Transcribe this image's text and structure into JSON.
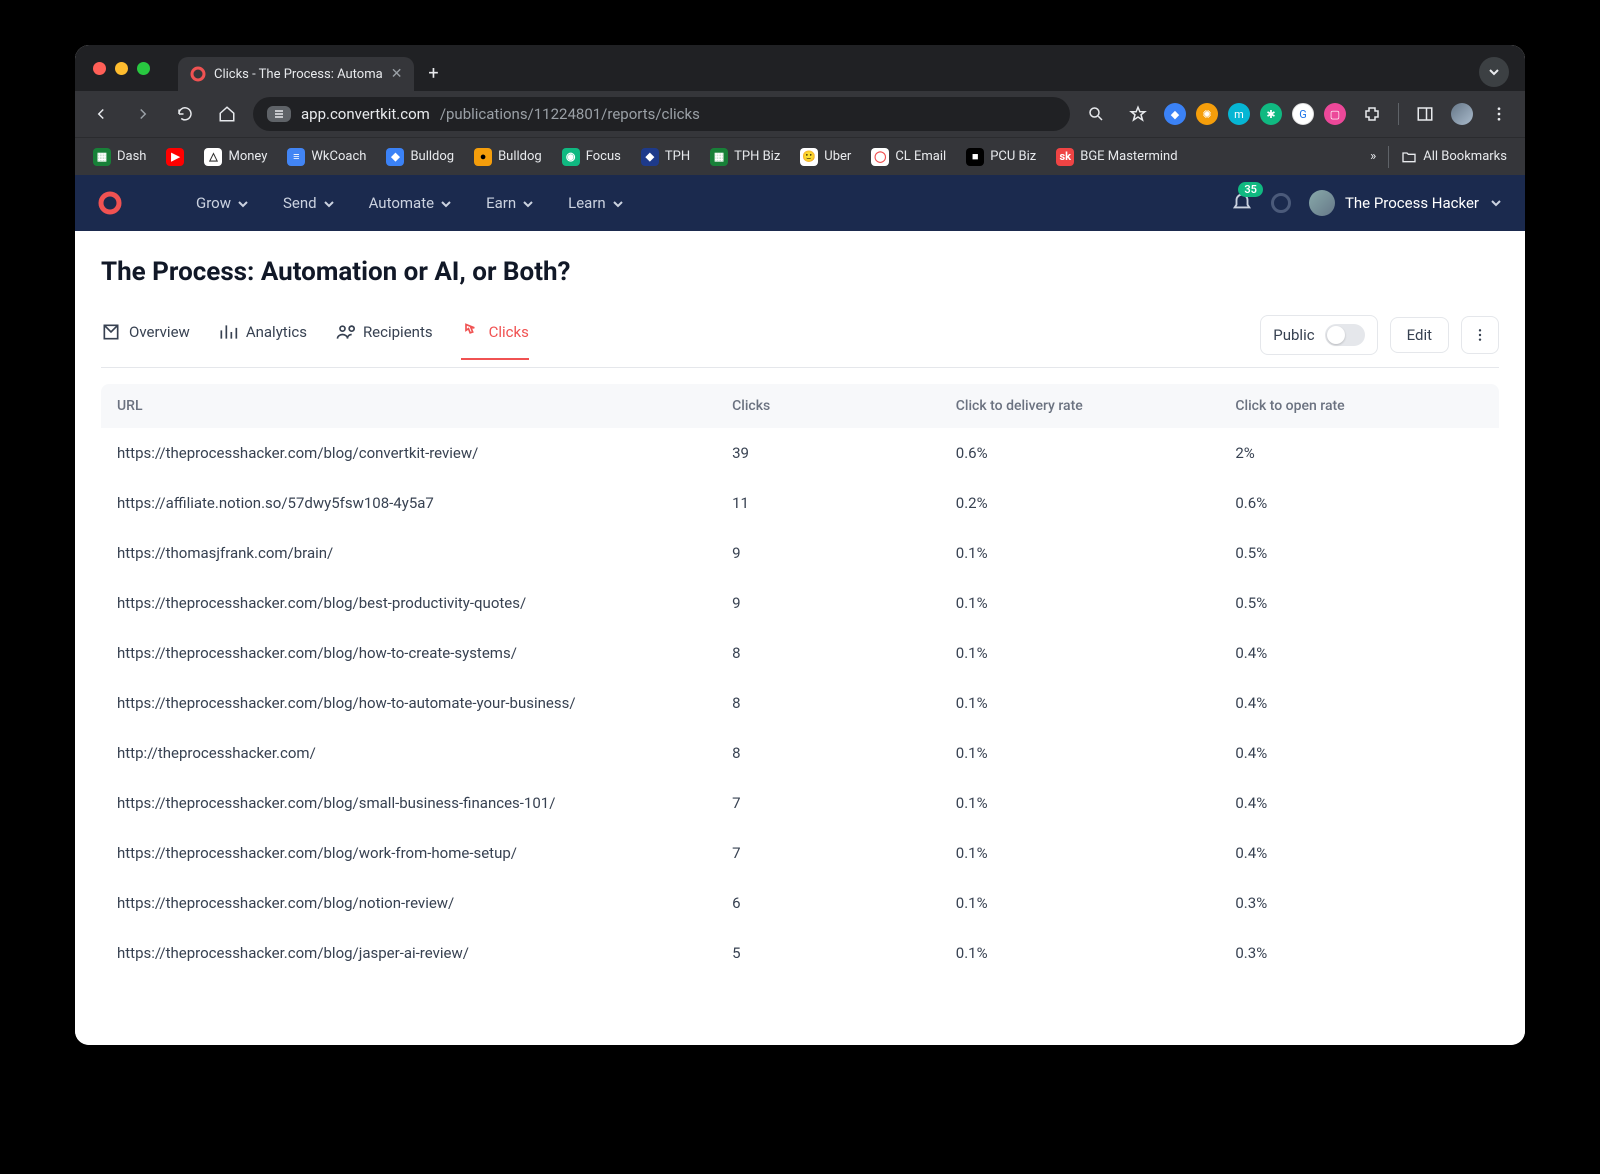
{
  "browser": {
    "tab_title": "Clicks - The Process: Automa",
    "new_tab_label": "+",
    "url_host": "app.convertkit.com",
    "url_path": "/publications/11224801/reports/clicks",
    "bookmarks": [
      {
        "label": "Dash",
        "bg": "#188038",
        "fg": "#fff",
        "ch": "▦"
      },
      {
        "label": "",
        "bg": "#ff0000",
        "fg": "#fff",
        "ch": "▶"
      },
      {
        "label": "Money",
        "bg": "#ffffff",
        "fg": "#333",
        "ch": "△"
      },
      {
        "label": "WkCoach",
        "bg": "#4285f4",
        "fg": "#fff",
        "ch": "≡"
      },
      {
        "label": "Bulldog",
        "bg": "#3b82f6",
        "fg": "#fff",
        "ch": "◆"
      },
      {
        "label": "Bulldog",
        "bg": "#f59e0b",
        "fg": "#000",
        "ch": "●"
      },
      {
        "label": "Focus",
        "bg": "#10b981",
        "fg": "#fff",
        "ch": "◉"
      },
      {
        "label": "TPH",
        "bg": "#1e3a8a",
        "fg": "#fff",
        "ch": "◆"
      },
      {
        "label": "TPH Biz",
        "bg": "#188038",
        "fg": "#fff",
        "ch": "▦"
      },
      {
        "label": "Uber",
        "bg": "#ffffff",
        "fg": "#333",
        "ch": "🙂"
      },
      {
        "label": "CL Email",
        "bg": "#ffffff",
        "fg": "#f05252",
        "ch": "◯"
      },
      {
        "label": "PCU Biz",
        "bg": "#000000",
        "fg": "#fff",
        "ch": "■"
      },
      {
        "label": "BGE Mastermind",
        "bg": "#ef4444",
        "fg": "#fff",
        "ch": "sk"
      }
    ],
    "all_bookmarks_label": "All Bookmarks"
  },
  "app": {
    "nav": [
      "Grow",
      "Send",
      "Automate",
      "Earn",
      "Learn"
    ],
    "notification_count": "35",
    "account_name": "The Process Hacker"
  },
  "page": {
    "title": "The Process: Automation or AI, or Both?",
    "tabs": [
      {
        "label": "Overview",
        "active": false
      },
      {
        "label": "Analytics",
        "active": false
      },
      {
        "label": "Recipients",
        "active": false
      },
      {
        "label": "Clicks",
        "active": true
      }
    ],
    "public_label": "Public",
    "edit_label": "Edit",
    "columns": {
      "url": "URL",
      "clicks": "Clicks",
      "delivery": "Click to delivery rate",
      "open": "Click to open rate"
    },
    "rows": [
      {
        "url": "https://theprocesshacker.com/blog/convertkit-review/",
        "clicks": "39",
        "delivery": "0.6%",
        "open": "2%"
      },
      {
        "url": "https://affiliate.notion.so/57dwy5fsw108-4y5a7",
        "clicks": "11",
        "delivery": "0.2%",
        "open": "0.6%"
      },
      {
        "url": "https://thomasjfrank.com/brain/",
        "clicks": "9",
        "delivery": "0.1%",
        "open": "0.5%"
      },
      {
        "url": "https://theprocesshacker.com/blog/best-productivity-quotes/",
        "clicks": "9",
        "delivery": "0.1%",
        "open": "0.5%"
      },
      {
        "url": "https://theprocesshacker.com/blog/how-to-create-systems/",
        "clicks": "8",
        "delivery": "0.1%",
        "open": "0.4%"
      },
      {
        "url": "https://theprocesshacker.com/blog/how-to-automate-your-business/",
        "clicks": "8",
        "delivery": "0.1%",
        "open": "0.4%"
      },
      {
        "url": "http://theprocesshacker.com/",
        "clicks": "8",
        "delivery": "0.1%",
        "open": "0.4%"
      },
      {
        "url": "https://theprocesshacker.com/blog/small-business-finances-101/",
        "clicks": "7",
        "delivery": "0.1%",
        "open": "0.4%"
      },
      {
        "url": "https://theprocesshacker.com/blog/work-from-home-setup/",
        "clicks": "7",
        "delivery": "0.1%",
        "open": "0.4%"
      },
      {
        "url": "https://theprocesshacker.com/blog/notion-review/",
        "clicks": "6",
        "delivery": "0.1%",
        "open": "0.3%"
      },
      {
        "url": "https://theprocesshacker.com/blog/jasper-ai-review/",
        "clicks": "5",
        "delivery": "0.1%",
        "open": "0.3%"
      }
    ]
  }
}
